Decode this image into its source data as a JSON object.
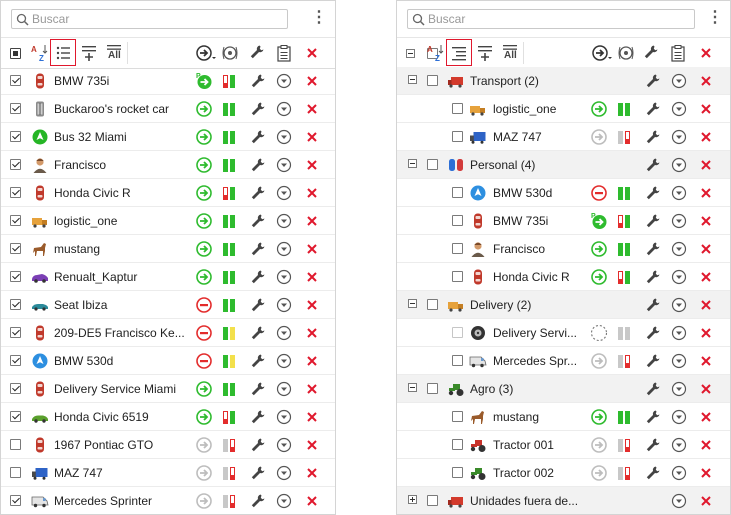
{
  "search": {
    "placeholder": "Buscar"
  },
  "colors": {
    "accent_red": "#e0182d",
    "green": "#2ebb2e",
    "red": "#e32c2c",
    "grey": "#c8c8c8",
    "yellow": "#f3e04b"
  },
  "left_panel": {
    "toolbar": {
      "sort_label": "A-Z",
      "all_label": "All",
      "active": "list-view"
    },
    "units": [
      {
        "name": "BMW 735i",
        "checked": true,
        "icon": "car-red-icon",
        "state": "moving-parked",
        "bars": [
          "red",
          "green"
        ]
      },
      {
        "name": "Buckaroo's rocket car",
        "checked": true,
        "icon": "rocket-car-icon",
        "state": "arrow",
        "bars": [
          "green",
          "green"
        ]
      },
      {
        "name": "Bus 32 Miami",
        "checked": true,
        "icon": "bus-marker-icon",
        "state": "arrow",
        "bars": [
          "green",
          "green"
        ]
      },
      {
        "name": "Francisco",
        "checked": true,
        "icon": "person-icon",
        "state": "arrow",
        "bars": [
          "green",
          "green"
        ]
      },
      {
        "name": "Honda Civic R",
        "checked": true,
        "icon": "car-red-icon",
        "state": "arrow",
        "bars": [
          "red",
          "green"
        ]
      },
      {
        "name": "logistic_one",
        "checked": true,
        "icon": "truck-orange-icon",
        "state": "arrow",
        "bars": [
          "green",
          "green"
        ]
      },
      {
        "name": "mustang",
        "checked": true,
        "icon": "horse-icon",
        "state": "arrow",
        "bars": [
          "green",
          "green"
        ]
      },
      {
        "name": "Renualt_Kaptur",
        "checked": true,
        "icon": "car-purple-icon",
        "state": "arrow",
        "bars": [
          "green",
          "green"
        ]
      },
      {
        "name": "Seat Ibiza",
        "checked": true,
        "icon": "car-teal-icon",
        "state": "stop",
        "bars": [
          "green",
          "green"
        ]
      },
      {
        "name": "209-DE5 Francisco Ke...",
        "checked": true,
        "icon": "car-red-icon",
        "state": "stop",
        "bars": [
          "green",
          "yellow"
        ]
      },
      {
        "name": "BMW 530d",
        "checked": true,
        "icon": "arrow-marker-icon",
        "state": "stop",
        "bars": [
          "green",
          "yellow"
        ]
      },
      {
        "name": "Delivery Service Miami",
        "checked": true,
        "icon": "car-red-icon",
        "state": "arrow",
        "bars": [
          "green",
          "green"
        ]
      },
      {
        "name": "Honda Civic 6519",
        "checked": true,
        "icon": "car-green-icon",
        "state": "arrow",
        "bars": [
          "red",
          "green"
        ]
      },
      {
        "name": "1967 Pontiac GTO",
        "checked": false,
        "icon": "car-red-icon",
        "state": "grey",
        "bars": [
          "grey",
          "red"
        ]
      },
      {
        "name": "MAZ 747",
        "checked": false,
        "icon": "truck-blue-icon",
        "state": "grey",
        "bars": [
          "grey",
          "red"
        ]
      },
      {
        "name": "Mercedes Sprinter",
        "checked": true,
        "icon": "van-icon",
        "state": "grey",
        "bars": [
          "grey",
          "red"
        ]
      }
    ]
  },
  "right_panel": {
    "toolbar": {
      "sort_label": "A-Z",
      "all_label": "All",
      "active": "group-view"
    },
    "rows": [
      {
        "kind": "group",
        "name": "Transport (2)",
        "icon": "truck-red-icon",
        "expanded": true
      },
      {
        "kind": "unit",
        "name": "logistic_one",
        "icon": "truck-orange-icon",
        "state": "arrow",
        "bars": [
          "green",
          "green"
        ]
      },
      {
        "kind": "unit",
        "name": "MAZ 747",
        "icon": "truck-blue-icon",
        "state": "grey",
        "bars": [
          "grey",
          "red"
        ]
      },
      {
        "kind": "group",
        "name": "Personal (4)",
        "icon": "people-icon",
        "expanded": true
      },
      {
        "kind": "unit",
        "name": "BMW 530d",
        "icon": "arrow-marker-icon",
        "state": "stop",
        "bars": [
          "green",
          "green"
        ]
      },
      {
        "kind": "unit",
        "name": "BMW 735i",
        "icon": "car-red-icon",
        "state": "moving-parked",
        "bars": [
          "red",
          "green"
        ]
      },
      {
        "kind": "unit",
        "name": "Francisco",
        "icon": "person-icon",
        "state": "arrow",
        "bars": [
          "green",
          "green"
        ]
      },
      {
        "kind": "unit",
        "name": "Honda Civic R",
        "icon": "car-red-icon",
        "state": "arrow",
        "bars": [
          "red",
          "green"
        ]
      },
      {
        "kind": "group",
        "name": "Delivery (2)",
        "icon": "truck-orange-icon",
        "expanded": true
      },
      {
        "kind": "unit",
        "name": "Delivery Servi...",
        "icon": "wheel-icon",
        "state": "dashed",
        "bars": [
          "grey",
          "grey"
        ],
        "dim": true
      },
      {
        "kind": "unit",
        "name": "Mercedes Spr...",
        "icon": "van-icon",
        "state": "grey",
        "bars": [
          "grey",
          "red"
        ]
      },
      {
        "kind": "group",
        "name": "Agro (3)",
        "icon": "tractor-icon",
        "expanded": true
      },
      {
        "kind": "unit",
        "name": "mustang",
        "icon": "horse-icon",
        "state": "arrow",
        "bars": [
          "green",
          "green"
        ]
      },
      {
        "kind": "unit",
        "name": "Tractor 001",
        "icon": "tractor-red-icon",
        "state": "grey",
        "bars": [
          "grey",
          "red"
        ]
      },
      {
        "kind": "unit",
        "name": "Tractor 002",
        "icon": "tractor-green-icon",
        "state": "grey",
        "bars": [
          "grey",
          "red"
        ]
      },
      {
        "kind": "group",
        "name": "Unidades fuera de...",
        "icon": "truck-red-icon",
        "expanded": false
      }
    ]
  }
}
